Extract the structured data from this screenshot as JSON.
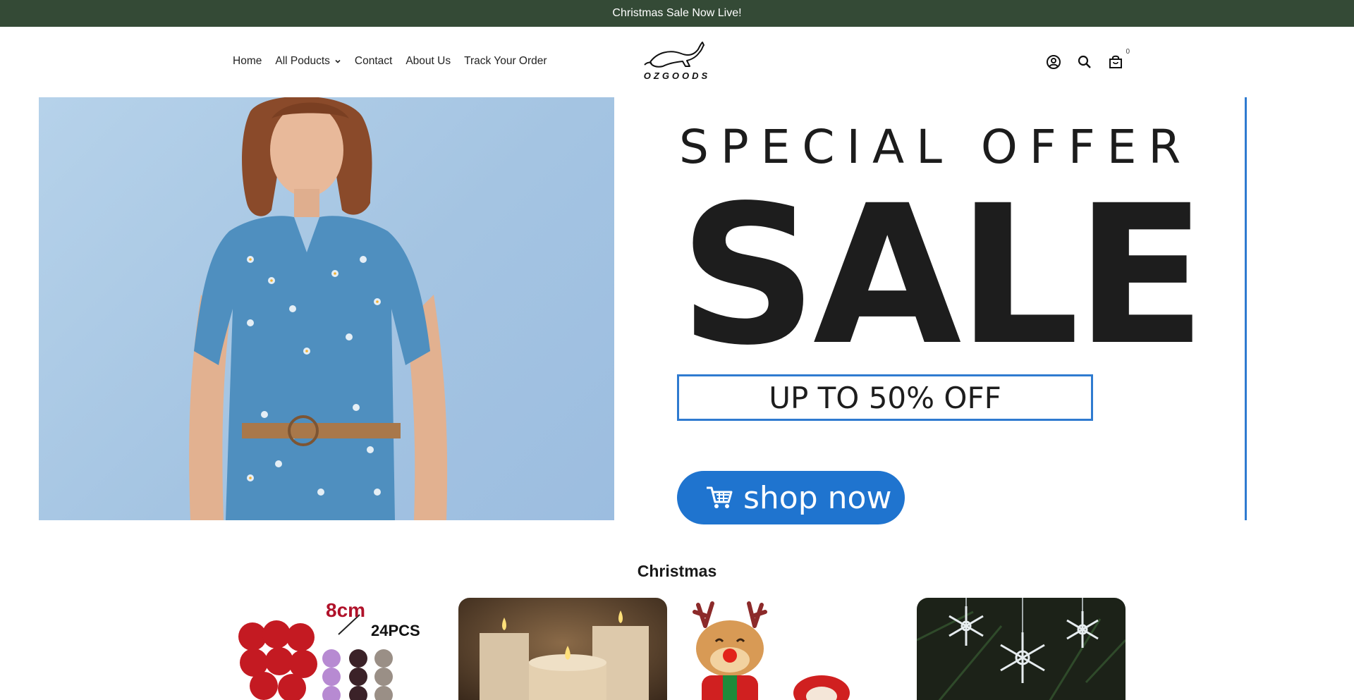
{
  "announcement": {
    "text": "Christmas Sale Now Live!"
  },
  "nav": {
    "items": [
      {
        "label": "Home"
      },
      {
        "label": "All Poducts"
      },
      {
        "label": "Contact"
      },
      {
        "label": "About Us"
      },
      {
        "label": "Track Your Order"
      }
    ]
  },
  "logo": {
    "text": "OZGOODS",
    "icon": "kangaroo-logo"
  },
  "header_icons": {
    "account": "account-icon",
    "search": "search-icon",
    "cart": "cart-icon",
    "cart_count": "0"
  },
  "hero": {
    "special_offer": "SPECIAL OFFER",
    "sale": "SALE",
    "discount": "UP TO 50% OFF",
    "cta": "shop now",
    "accent": "#2f7bd0"
  },
  "collection": {
    "title": "Christmas",
    "ornaments_size": "8cm",
    "ornaments_count": "24PCS"
  },
  "colors": {
    "announcement_bg": "#344a36",
    "button_blue": "#1f74cf"
  }
}
